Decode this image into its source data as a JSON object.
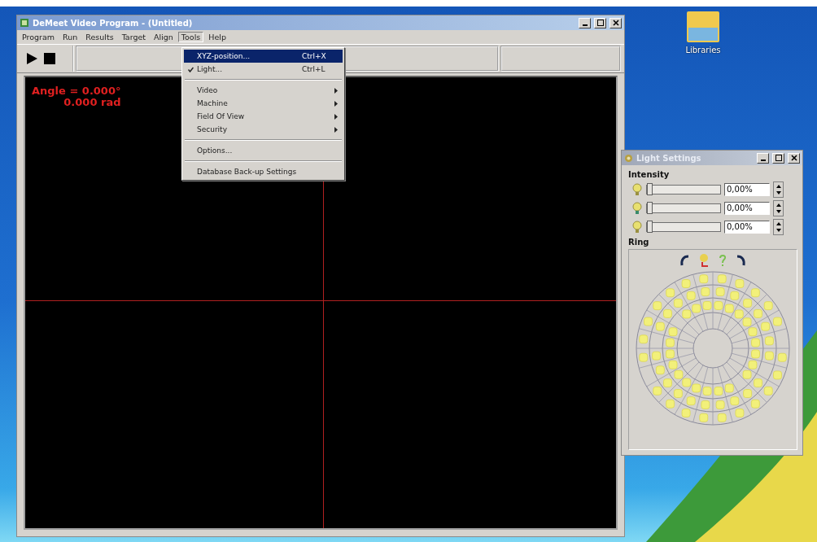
{
  "window": {
    "title": "DeMeet Video Program - (Untitled)"
  },
  "menu": [
    {
      "label": "Program",
      "selected": false
    },
    {
      "label": "Run",
      "selected": false
    },
    {
      "label": "Results",
      "selected": false
    },
    {
      "label": "Target",
      "selected": false
    },
    {
      "label": "Align",
      "selected": false
    },
    {
      "label": "Tools",
      "selected": true
    },
    {
      "label": "Help",
      "selected": false
    }
  ],
  "viewport": {
    "angle_deg": "Angle = 0.000°",
    "angle_rad": "0.000 rad"
  },
  "tools_menu": [
    {
      "kind": "item",
      "label": "XYZ-position...",
      "shortcut": "Ctrl+X",
      "checked": false,
      "selected": true,
      "submenu": false
    },
    {
      "kind": "item",
      "label": "Light...",
      "shortcut": "Ctrl+L",
      "checked": true,
      "selected": false,
      "submenu": false
    },
    {
      "kind": "separator"
    },
    {
      "kind": "item",
      "label": "Video",
      "checked": false,
      "selected": false,
      "submenu": true
    },
    {
      "kind": "item",
      "label": "Machine",
      "checked": false,
      "selected": false,
      "submenu": true
    },
    {
      "kind": "item",
      "label": "Field Of View",
      "checked": false,
      "selected": false,
      "submenu": true
    },
    {
      "kind": "item",
      "label": "Security",
      "checked": false,
      "selected": false,
      "submenu": true
    },
    {
      "kind": "separator"
    },
    {
      "kind": "item",
      "label": "Options...",
      "checked": false,
      "selected": false,
      "submenu": false
    },
    {
      "kind": "separator"
    },
    {
      "kind": "item",
      "label": "Database Back-up Settings",
      "checked": false,
      "selected": false,
      "submenu": false
    }
  ],
  "light_settings": {
    "title": "Light Settings",
    "intensity_label": "Intensity",
    "channels": [
      {
        "level": 0,
        "reading": "0,00%"
      },
      {
        "level": 0,
        "reading": "0,00%"
      },
      {
        "level": 0,
        "reading": "0,00%"
      }
    ],
    "ring_label": "Ring"
  },
  "desktop_icon": {
    "label": "Libraries"
  }
}
